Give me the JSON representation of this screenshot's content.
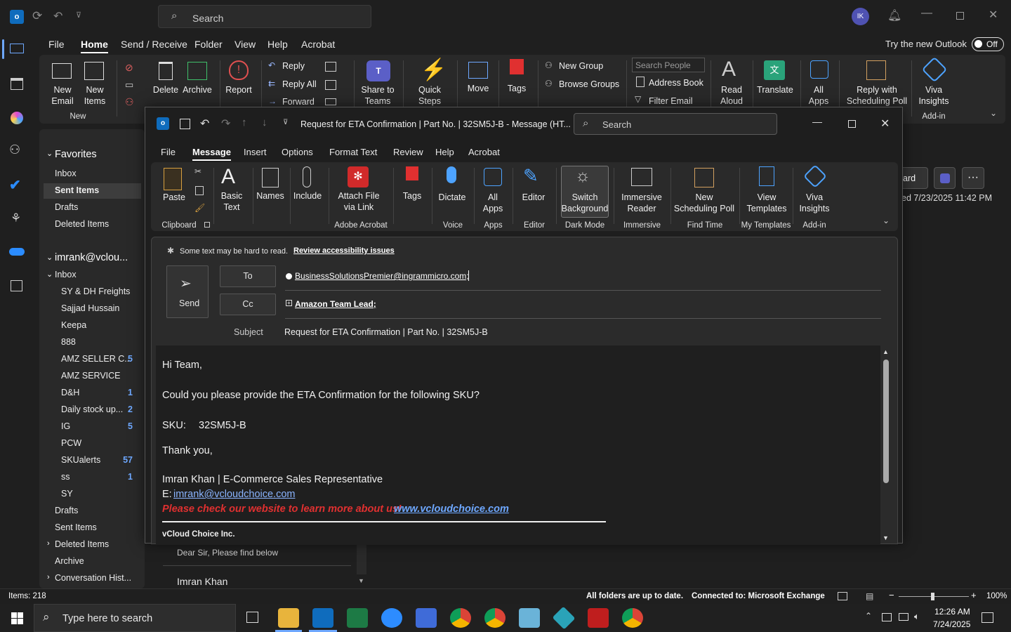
{
  "titlebar": {
    "search_placeholder": "Search",
    "avatar_initials": "IK"
  },
  "menu": {
    "items": [
      "File",
      "Home",
      "Send / Receive",
      "Folder",
      "View",
      "Help",
      "Acrobat"
    ],
    "try_new": "Try the new Outlook",
    "toggle": "Off"
  },
  "ribbon": {
    "new_email": "New\nEmail",
    "new_items": "New\nItems",
    "group_new": "New",
    "delete": "Delete",
    "archive": "Archive",
    "report": "Report",
    "reply": "Reply",
    "reply_all": "Reply All",
    "forward": "Forward",
    "share_teams": "Share to\nTeams",
    "quick_steps": "Quick\nSteps",
    "move": "Move",
    "tags": "Tags",
    "new_group": "New Group",
    "browse_groups": "Browse Groups",
    "search_people": "Search People",
    "address_book": "Address Book",
    "filter_email": "Filter Email",
    "read_aloud": "Read\nAloud",
    "translate": "Translate",
    "all_apps": "All\nApps",
    "reply_sched": "Reply with\nScheduling Poll",
    "viva": "Viva\nInsights",
    "group_addin": "Add-in"
  },
  "folders": {
    "favorites": "Favorites",
    "fav_items": [
      "Inbox",
      "Sent Items",
      "Drafts",
      "Deleted Items"
    ],
    "account": "imrank@vclou...",
    "inbox": "Inbox",
    "subfolders": [
      {
        "name": "SY & DH Freights",
        "count": ""
      },
      {
        "name": "Sajjad Hussain",
        "count": ""
      },
      {
        "name": "Keepa",
        "count": ""
      },
      {
        "name": "888",
        "count": ""
      },
      {
        "name": "AMZ SELLER C...",
        "count": "5"
      },
      {
        "name": "AMZ SERVICE",
        "count": ""
      },
      {
        "name": "D&H",
        "count": "1"
      },
      {
        "name": "Daily stock up...",
        "count": "2"
      },
      {
        "name": "IG",
        "count": "5"
      },
      {
        "name": "PCW",
        "count": ""
      },
      {
        "name": "SKUalerts",
        "count": "57"
      },
      {
        "name": "ss",
        "count": "1"
      },
      {
        "name": "SY",
        "count": ""
      }
    ],
    "after": [
      "Drafts",
      "Sent Items",
      "Deleted Items",
      "Archive",
      "Conversation Hist..."
    ]
  },
  "msglist": {
    "preview": "Dear Sir,  Please find below",
    "sender": "Imran Khan"
  },
  "readpane": {
    "forward_label": "ward",
    "date": "ed 7/23/2025 11:42 PM"
  },
  "compose": {
    "title": "Request for ETA Confirmation | Part No. | 32SM5J-B  -  Message (HT...",
    "search_placeholder": "Search",
    "tabs": [
      "File",
      "Message",
      "Insert",
      "Options",
      "Format Text",
      "Review",
      "Help",
      "Acrobat"
    ],
    "ribbon": {
      "paste": "Paste",
      "basic_text": "Basic\nText",
      "names": "Names",
      "include": "Include",
      "attach": "Attach File\nvia Link",
      "tags": "Tags",
      "dictate": "Dictate",
      "all_apps": "All\nApps",
      "editor": "Editor",
      "switch_bg": "Switch\nBackground",
      "immersive": "Immersive\nReader",
      "new_poll": "New\nScheduling Poll",
      "view_templates": "View\nTemplates",
      "viva": "Viva\nInsights",
      "groups": [
        "Clipboard",
        "Adobe Acrobat",
        "Voice",
        "Apps",
        "Editor",
        "Dark Mode",
        "Immersive",
        "Find Time",
        "My Templates",
        "Add-in"
      ]
    },
    "accessibility": "Some text may be hard to read.",
    "accessibility_link": "Review accessibility issues",
    "send": "Send",
    "to_label": "To",
    "cc_label": "Cc",
    "to_value": "BusinessSolutionsPremier@ingrammicro.com;",
    "cc_value": "Amazon Team Lead;",
    "subject_label": "Subject",
    "subject_value": "Request for ETA Confirmation | Part No. | 32SM5J-B",
    "body": {
      "greeting": "Hi Team,",
      "line1": "Could you please provide the ETA Confirmation for the following SKU?",
      "sku_label": "SKU:",
      "sku_value": "32SM5J-B",
      "thanks": "Thank you,",
      "sig_name": "Imran Khan | E-Commerce Sales Representative",
      "sig_email_label": "E:",
      "sig_email": "imrank@vcloudchoice.com",
      "promo": "Please check our website to learn more about us!",
      "promo_link": "www.vcloudchoice.com",
      "company": "vCloud Choice Inc."
    }
  },
  "status": {
    "items": "Items: 218",
    "sync": "All folders are up to date.",
    "connected": "Connected to: Microsoft Exchange",
    "zoom": "100%"
  },
  "taskbar": {
    "search": "Type here to search",
    "time": "12:26 AM",
    "date": "7/24/2025"
  },
  "colors": {
    "accent": "#4f52b2",
    "link": "#6ea8ff",
    "promo": "#e03030"
  }
}
